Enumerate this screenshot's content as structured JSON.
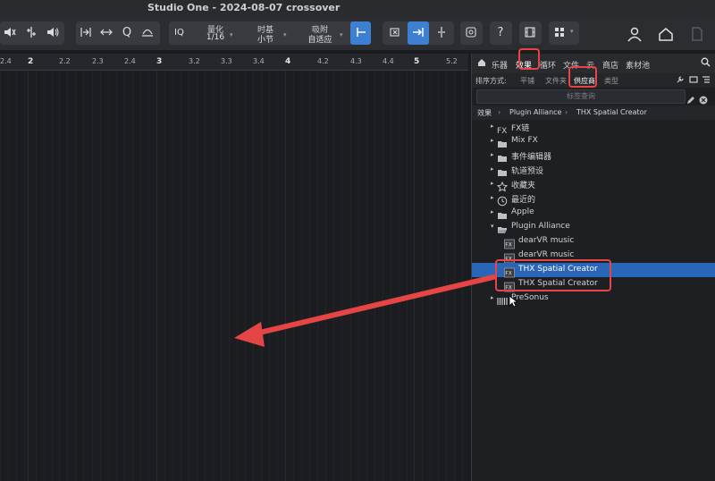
{
  "window": {
    "title": "Studio One - 2024-08-07 crossover"
  },
  "toolbar": {
    "quantize_label": "量化",
    "quantize_value": "1/16",
    "timebase_label": "时基",
    "timebase_value": "小节",
    "snap_label": "吸附",
    "snap_value": "自适应",
    "iq_label": "IQ",
    "help_label": "?"
  },
  "ruler": {
    "ticks": [
      "2.4",
      "2",
      "2.2",
      "2.3",
      "2.4",
      "3",
      "3.2",
      "3.3",
      "3.4",
      "4",
      "4.2",
      "4.3",
      "4.4",
      "5",
      "5.2"
    ]
  },
  "browser": {
    "tabs": [
      "乐器",
      "效果",
      "循环",
      "文件",
      "云",
      "商店",
      "素材池"
    ],
    "active_tab": "效果",
    "sort_label": "排序方式:",
    "sort_options": [
      "平铺",
      "文件夹",
      "供应商",
      "类型"
    ],
    "active_sort": "供应商",
    "search_placeholder": "标签查询",
    "breadcrumb": [
      "效果",
      "Plugin Alliance",
      "THX Spatial Creator"
    ],
    "items": [
      {
        "label": "FX链",
        "icon": "fx-chain-icon"
      },
      {
        "label": "Mix FX",
        "icon": "folder-icon"
      },
      {
        "label": "事件编辑器",
        "icon": "folder-icon"
      },
      {
        "label": "轨道预设",
        "icon": "folder-icon"
      },
      {
        "label": "收藏夹",
        "icon": "star-icon"
      },
      {
        "label": "最近的",
        "icon": "clock-icon"
      },
      {
        "label": "Apple",
        "icon": "folder-icon"
      },
      {
        "label": "Plugin Alliance",
        "icon": "open-folder-icon"
      },
      {
        "label": "dearVR music",
        "icon": "plugin-icon"
      },
      {
        "label": "dearVR music",
        "icon": "plugin-icon"
      },
      {
        "label": "THX Spatial Creator",
        "icon": "plugin-icon"
      },
      {
        "label": "THX Spatial Creator",
        "icon": "plugin-icon"
      },
      {
        "label": "PreSonus",
        "icon": "presonus-icon"
      }
    ]
  },
  "colors": {
    "selection": "#2a66b8",
    "highlight": "#e64545",
    "active_button": "#3d7fd1"
  }
}
